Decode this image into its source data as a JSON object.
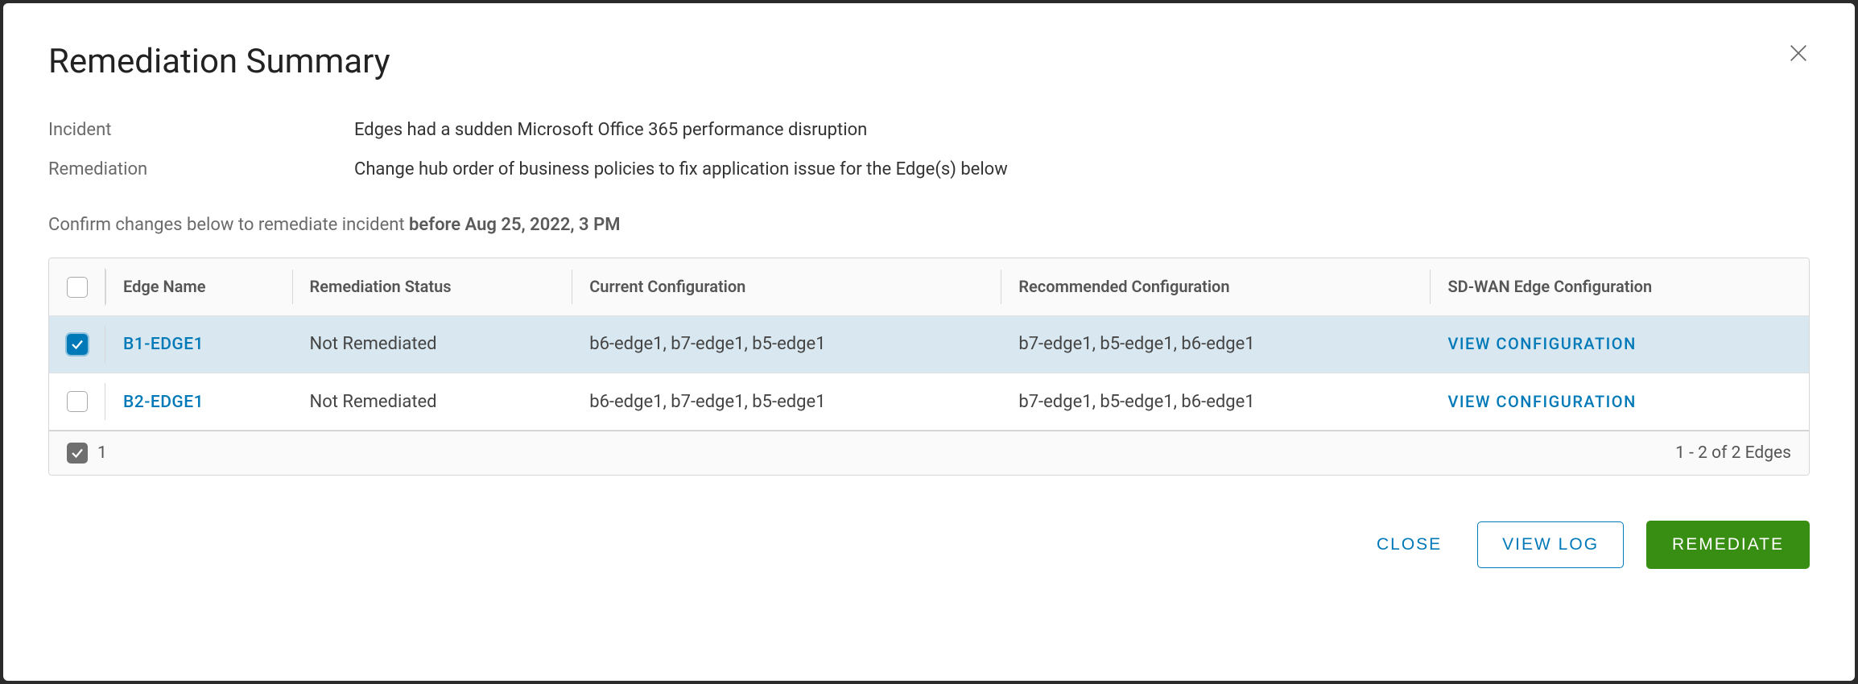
{
  "dialog": {
    "title": "Remediation Summary"
  },
  "incident": {
    "label": "Incident",
    "value": "Edges had a sudden Microsoft Office 365 performance disruption"
  },
  "remediation": {
    "label": "Remediation",
    "value": "Change hub order of business policies to fix application issue for the Edge(s) below"
  },
  "confirm": {
    "prefix": "Confirm changes below to remediate incident ",
    "bold": "before Aug 25, 2022, 3 PM"
  },
  "table": {
    "headers": {
      "edge_name": "Edge Name",
      "remediation_status": "Remediation Status",
      "current_config": "Current Configuration",
      "recommended_config": "Recommended Configuration",
      "sdwan_config": "SD-WAN Edge Configuration"
    },
    "rows": [
      {
        "selected": true,
        "edge_name": "B1-EDGE1",
        "remediation_status": "Not Remediated",
        "current_config": "b6-edge1, b7-edge1, b5-edge1",
        "recommended_config": "b7-edge1, b5-edge1, b6-edge1",
        "view_label": "VIEW CONFIGURATION"
      },
      {
        "selected": false,
        "edge_name": "B2-EDGE1",
        "remediation_status": "Not Remediated",
        "current_config": "b6-edge1, b7-edge1, b5-edge1",
        "recommended_config": "b7-edge1, b5-edge1, b6-edge1",
        "view_label": "VIEW CONFIGURATION"
      }
    ],
    "footer": {
      "selected_count": "1",
      "range": "1 - 2 of 2 Edges"
    }
  },
  "actions": {
    "close": "CLOSE",
    "view_log": "VIEW LOG",
    "remediate": "REMEDIATE"
  }
}
